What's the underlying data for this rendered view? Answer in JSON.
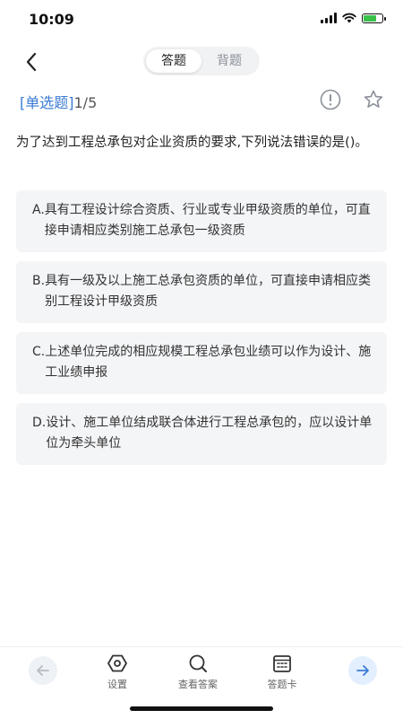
{
  "status": {
    "time": "10:09"
  },
  "header": {
    "tabs": [
      {
        "label": "答题",
        "active": true
      },
      {
        "label": "背题",
        "active": false
      }
    ]
  },
  "question": {
    "type_label": "[单选题]",
    "progress": "1/5",
    "text": "为了达到工程总承包对企业资质的要求,下列说法错误的是()。",
    "options": [
      {
        "letter": "A.",
        "text": "具有工程设计综合资质、行业或专业甲级资质的单位，可直接申请相应类别施工总承包一级资质"
      },
      {
        "letter": "B.",
        "text": "具有一级及以上施工总承包资质的单位，可直接申请相应类别工程设计甲级资质"
      },
      {
        "letter": "C.",
        "text": "上述单位完成的相应规模工程总承包业绩可以作为设计、施工业绩申报"
      },
      {
        "letter": "D.",
        "text": "设计、施工单位结成联合体进行工程总承包的，应以设计单位为牵头单位"
      }
    ]
  },
  "bottom": {
    "settings_label": "设置",
    "view_answer_label": "查看答案",
    "answer_card_label": "答题卡"
  },
  "colors": {
    "accent": "#3a7bd5",
    "option_bg": "#f4f5f7",
    "next_bg": "#e3efff"
  }
}
